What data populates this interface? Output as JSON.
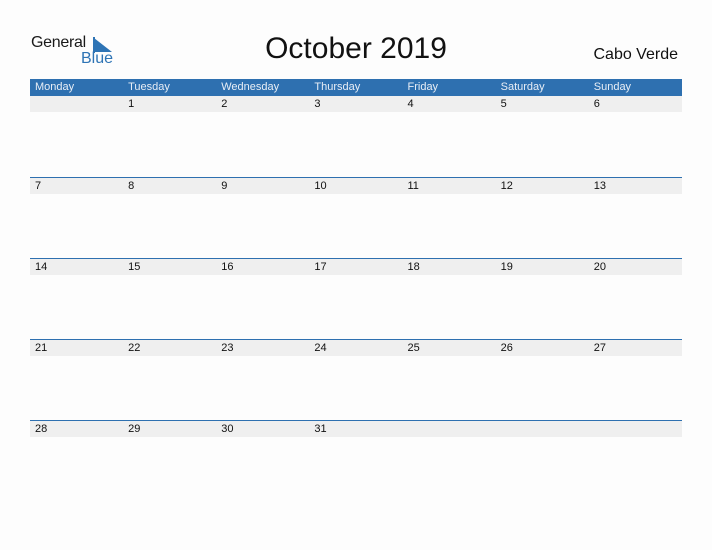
{
  "logo": {
    "word1": "General",
    "word2": "Blue"
  },
  "title": "October 2019",
  "country": "Cabo Verde",
  "days": [
    "Monday",
    "Tuesday",
    "Wednesday",
    "Thursday",
    "Friday",
    "Saturday",
    "Sunday"
  ],
  "weeks": [
    [
      "",
      "1",
      "2",
      "3",
      "4",
      "5",
      "6"
    ],
    [
      "7",
      "8",
      "9",
      "10",
      "11",
      "12",
      "13"
    ],
    [
      "14",
      "15",
      "16",
      "17",
      "18",
      "19",
      "20"
    ],
    [
      "21",
      "22",
      "23",
      "24",
      "25",
      "26",
      "27"
    ],
    [
      "28",
      "29",
      "30",
      "31",
      "",
      "",
      ""
    ]
  ],
  "colors": {
    "accent": "#2e70b0",
    "strip": "#efefef"
  }
}
